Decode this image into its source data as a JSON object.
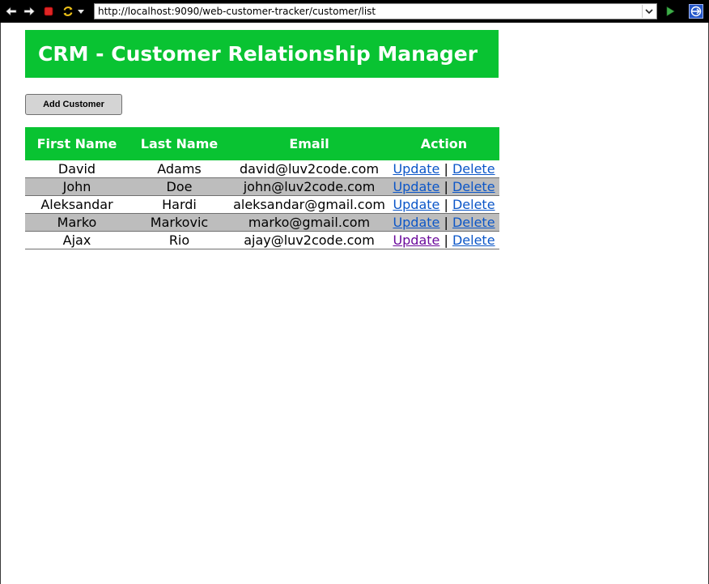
{
  "browser": {
    "url": "http://localhost:9090/web-customer-tracker/customer/list"
  },
  "page": {
    "title": "CRM - Customer Relationship Manager",
    "add_button_label": "Add Customer"
  },
  "table": {
    "headers": [
      "First Name",
      "Last Name",
      "Email",
      "Action"
    ],
    "rows": [
      {
        "first_name": "David",
        "last_name": "Adams",
        "email": "david@luv2code.com"
      },
      {
        "first_name": "John",
        "last_name": "Doe",
        "email": "john@luv2code.com"
      },
      {
        "first_name": "Aleksandar",
        "last_name": "Hardi",
        "email": "aleksandar@gmail.com"
      },
      {
        "first_name": "Marko",
        "last_name": "Markovic",
        "email": "marko@gmail.com"
      },
      {
        "first_name": "Ajax",
        "last_name": "Rio",
        "email": "ajay@luv2code.com"
      }
    ],
    "update_label": "Update",
    "delete_label": "Delete",
    "separator": "|"
  },
  "colors": {
    "accent": "#09c332",
    "alt_row": "#bdbdbd",
    "link": "#0b56c8",
    "visited_link": "#6b0a9c"
  }
}
